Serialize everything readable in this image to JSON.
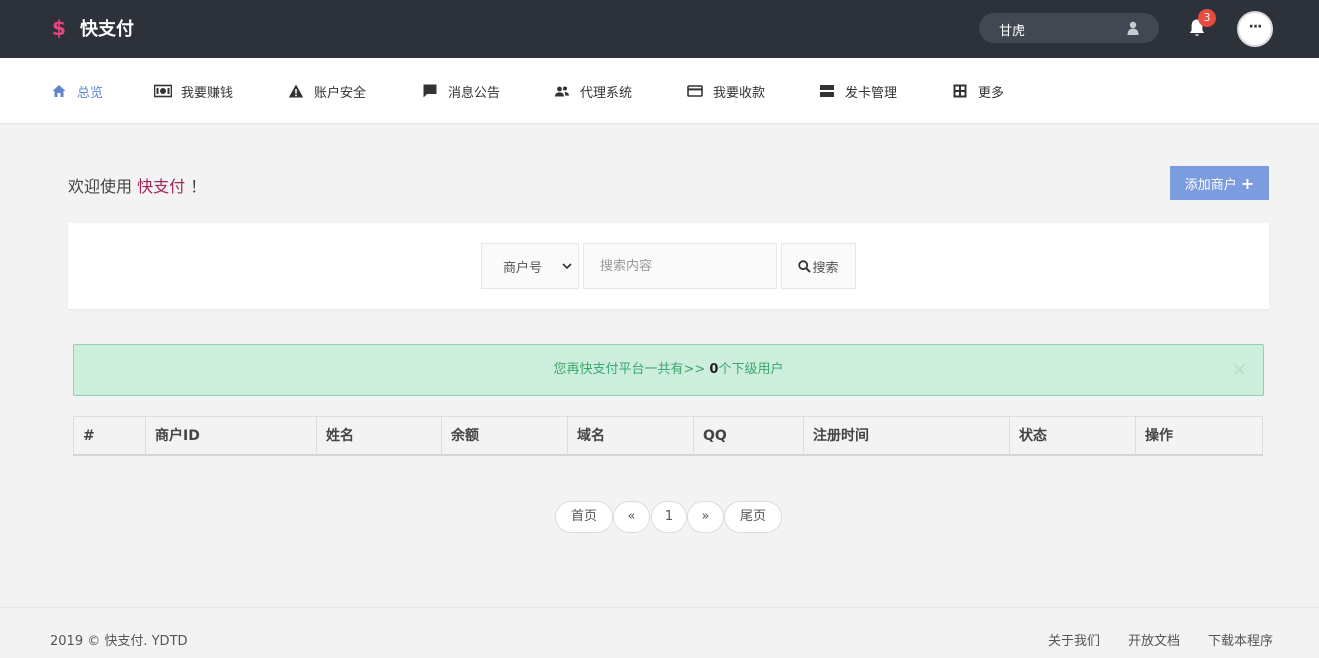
{
  "header": {
    "brand_icon": "$",
    "brand_name": "快支付",
    "user_name": "甘虎",
    "notification_count": "3",
    "more_label": "···"
  },
  "nav": {
    "items": [
      {
        "label": "总览",
        "icon": "home-icon"
      },
      {
        "label": "我要赚钱",
        "icon": "money-icon"
      },
      {
        "label": "账户安全",
        "icon": "warning-icon"
      },
      {
        "label": "消息公告",
        "icon": "message-icon"
      },
      {
        "label": "代理系统",
        "icon": "users-icon"
      },
      {
        "label": "我要收款",
        "icon": "credit-card-icon"
      },
      {
        "label": "发卡管理",
        "icon": "server-icon"
      },
      {
        "label": "更多",
        "icon": "puzzle-icon"
      }
    ]
  },
  "main": {
    "welcome_prefix": "欢迎使用 ",
    "welcome_brand": "快支付",
    "welcome_suffix": " ！",
    "add_button_label": "添加商户",
    "search": {
      "select_value": "商户号",
      "placeholder": "搜索内容",
      "button_label": "搜索"
    },
    "alert": {
      "text_before": "您再快支付平台一共有>> ",
      "count": "0",
      "text_after": "个下级用户",
      "close": "×"
    },
    "table": {
      "headers": [
        "#",
        "商户ID",
        "姓名",
        "余额",
        "域名",
        "QQ",
        "注册时间",
        "状态",
        "操作"
      ]
    },
    "pagination": {
      "first": "首页",
      "prev": "«",
      "current": "1",
      "next": "»",
      "last": "尾页"
    }
  },
  "footer": {
    "copyright": "2019 © 快支付. YDTD",
    "links": [
      "关于我们",
      "开放文档",
      "下载本程序"
    ]
  },
  "colors": {
    "topbar": "#2c313a",
    "accent": "#5f86cf",
    "brand_dollar": "#e8467c",
    "welcome_brand": "#a2255b",
    "add_button": "#7b9cde",
    "alert_bg": "#cdeddd",
    "alert_text": "#3aa86c",
    "badge": "#e74c3c"
  }
}
